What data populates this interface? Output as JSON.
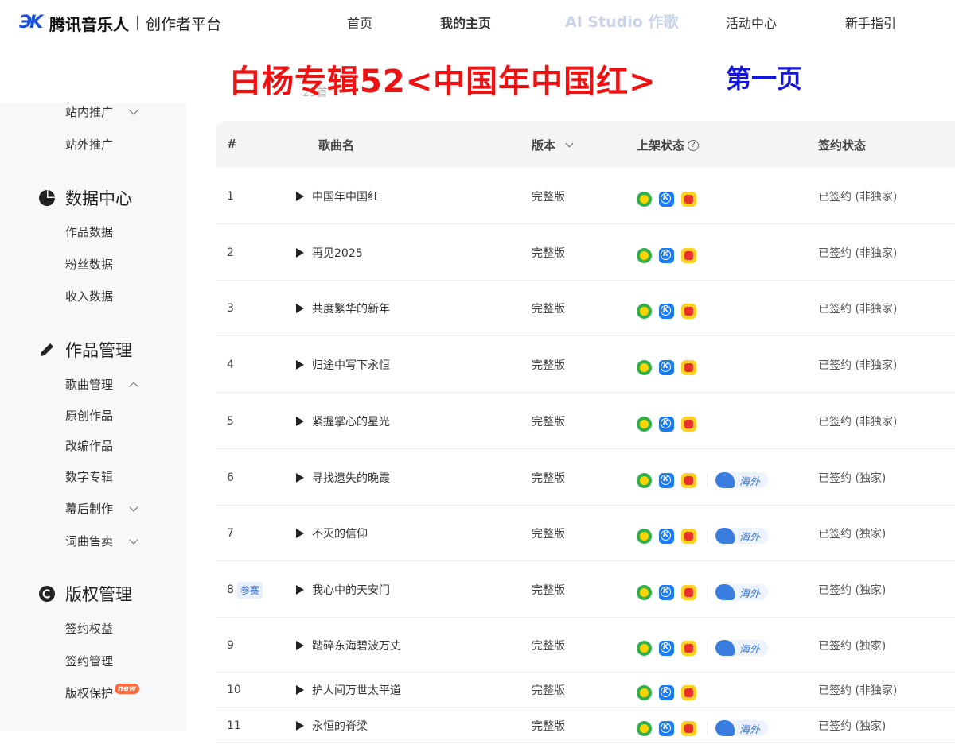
{
  "header": {
    "brand": "腾讯音乐人",
    "subtitle": "创作者平台",
    "nav": [
      "首页",
      "我的主页",
      "AI Studio 作歌",
      "活动中心",
      "新手指引"
    ]
  },
  "banner": {
    "title": "白杨专辑52<中国年中国红>",
    "page": "第一页",
    "ghost": "23首"
  },
  "sidebar": {
    "promo_items": [
      "站内推广",
      "站外推广"
    ],
    "groups": [
      {
        "label": "数据中心",
        "icon": "pie-chart-icon",
        "items": [
          "作品数据",
          "粉丝数据",
          "收入数据"
        ]
      },
      {
        "label": "作品管理",
        "icon": "pencil-icon",
        "items": [
          "歌曲管理",
          "原创作品",
          "改编作品",
          "数字专辑",
          "幕后制作",
          "词曲售卖"
        ]
      },
      {
        "label": "版权管理",
        "icon": "copyright-icon",
        "items": [
          "签约权益",
          "签约管理",
          "版权保护"
        ]
      }
    ],
    "new_badge": "new"
  },
  "table": {
    "headers": {
      "index": "#",
      "song": "歌曲名",
      "version": "版本",
      "status": "上架状态",
      "sign": "签约状态"
    },
    "rows": [
      {
        "index": "1",
        "song": "中国年中国红",
        "version": "完整版",
        "overseas": "",
        "sign": "已签约 (非独家)",
        "tag": ""
      },
      {
        "index": "2",
        "song": "再见2025",
        "version": "完整版",
        "overseas": "",
        "sign": "已签约 (非独家)",
        "tag": ""
      },
      {
        "index": "3",
        "song": "共度繁华的新年",
        "version": "完整版",
        "overseas": "",
        "sign": "已签约 (非独家)",
        "tag": ""
      },
      {
        "index": "4",
        "song": "归途中写下永恒",
        "version": "完整版",
        "overseas": "",
        "sign": "已签约 (非独家)",
        "tag": ""
      },
      {
        "index": "5",
        "song": "紧握掌心的星光",
        "version": "完整版",
        "overseas": "",
        "sign": "已签约 (非独家)",
        "tag": ""
      },
      {
        "index": "6",
        "song": "寻找遗失的晚霞",
        "version": "完整版",
        "overseas": "海外",
        "sign": "已签约 (独家)",
        "tag": ""
      },
      {
        "index": "7",
        "song": "不灭的信仰",
        "version": "完整版",
        "overseas": "海外",
        "sign": "已签约 (独家)",
        "tag": ""
      },
      {
        "index": "8",
        "song": "我心中的天安门",
        "version": "完整版",
        "overseas": "海外",
        "sign": "已签约 (独家)",
        "tag": "参赛"
      },
      {
        "index": "9",
        "song": "踏碎东海碧波万丈",
        "version": "完整版",
        "overseas": "海外",
        "sign": "已签约 (独家)",
        "tag": ""
      },
      {
        "index": "10",
        "song": "护人间万世太平道",
        "version": "完整版",
        "overseas": "",
        "sign": "已签约 (非独家)",
        "tag": ""
      },
      {
        "index": "11",
        "song": "永恒的脊梁",
        "version": "完整版",
        "overseas": "海外",
        "sign": "已签约 (独家)",
        "tag": ""
      }
    ]
  }
}
